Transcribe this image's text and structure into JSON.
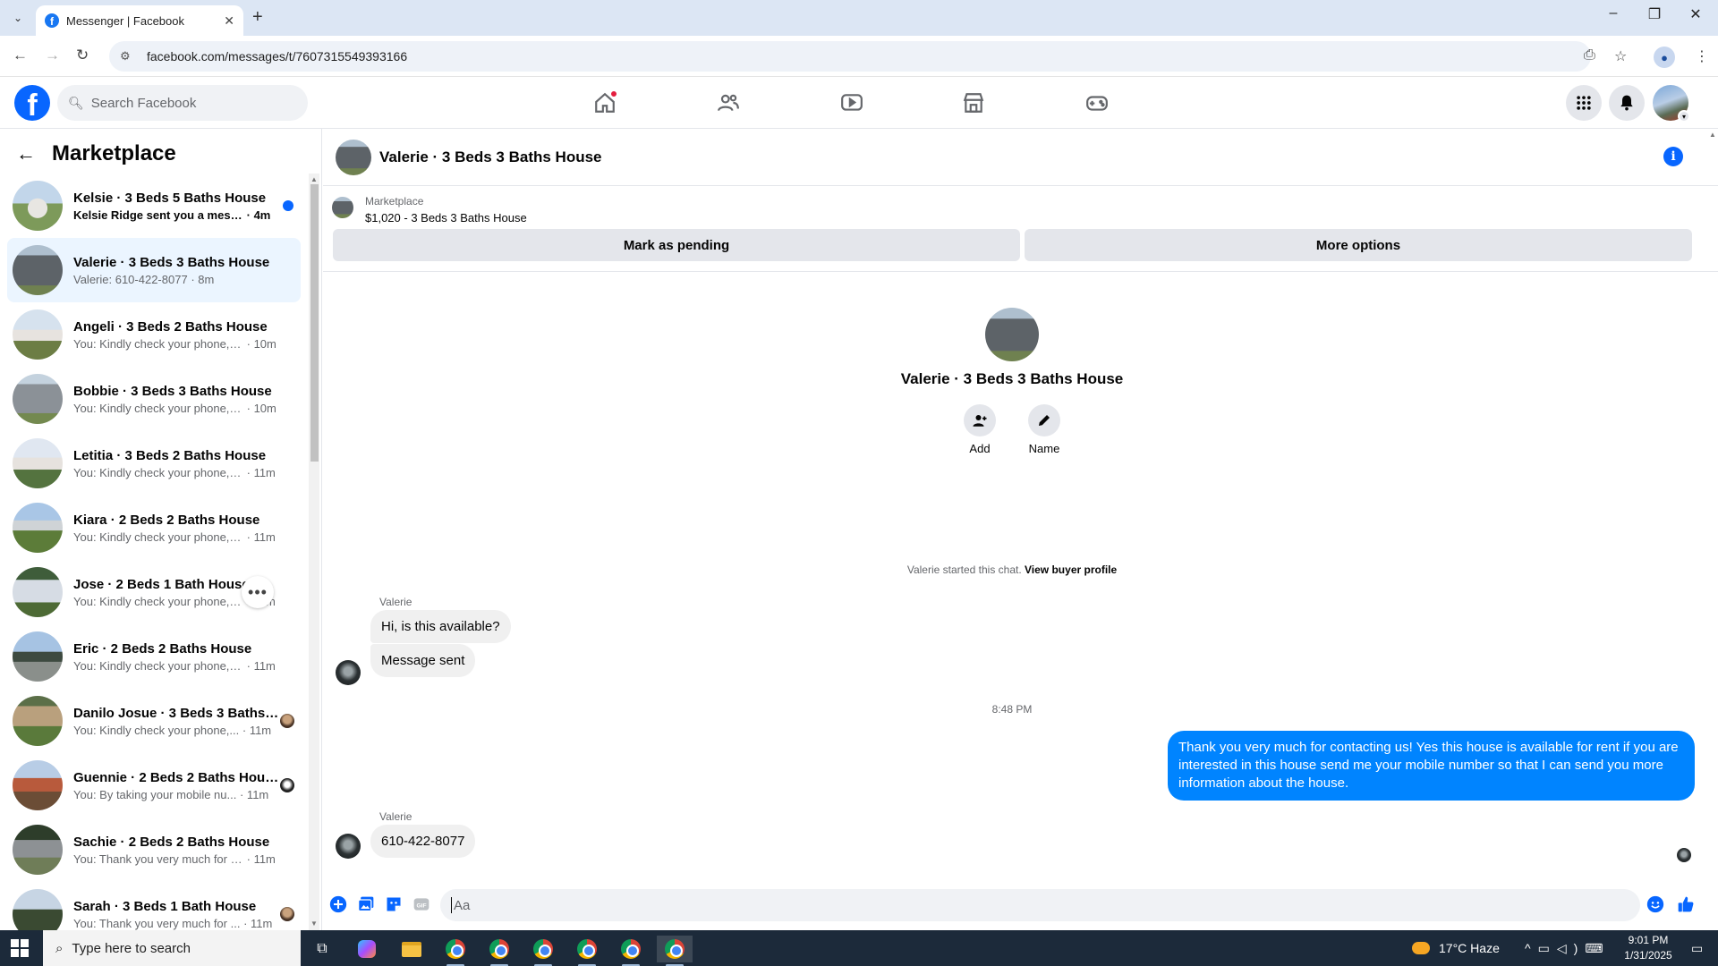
{
  "browser": {
    "tab_title": "Messenger | Facebook",
    "url": "facebook.com/messages/t/7607315549393166"
  },
  "fbnav": {
    "search_placeholder": "Search Facebook"
  },
  "sidebar": {
    "title": "Marketplace",
    "conversations": [
      {
        "name": "Kelsie · 3 Beds 5 Baths House",
        "preview": "Kelsie Ridge sent you a messag...",
        "time": "· 4m",
        "unread": true
      },
      {
        "name": "Valerie · 3 Beds 3 Baths House",
        "preview": "Valerie: 610-422-8077",
        "time": "· 8m",
        "active": true
      },
      {
        "name": "Angeli · 3 Beds 2 Baths House",
        "preview": "You: Kindly check your phone, I ...",
        "time": "· 10m"
      },
      {
        "name": "Bobbie · 3 Beds 3 Baths House",
        "preview": "You: Kindly check your phone, I ...",
        "time": "· 10m"
      },
      {
        "name": "Letitia · 3 Beds 2 Baths House",
        "preview": "You: Kindly check your phone, I ...",
        "time": "· 11m"
      },
      {
        "name": "Kiara · 2 Beds 2 Baths House",
        "preview": "You: Kindly check your phone, I ...",
        "time": "· 11m"
      },
      {
        "name": "Jose · 2 Beds 1 Bath House",
        "preview": "You: Kindly check your phone, I ...",
        "time": "· 11m"
      },
      {
        "name": "Eric · 2 Beds 2 Baths House",
        "preview": "You: Kindly check your phone, I ...",
        "time": "· 11m"
      },
      {
        "name": "Danilo Josue · 3 Beds 3 Baths ...",
        "preview": "You: Kindly check your phone,...",
        "time": "· 11m"
      },
      {
        "name": "Guennie · 2 Beds 2 Baths House",
        "preview": "You: By taking your mobile nu...",
        "time": "· 11m"
      },
      {
        "name": "Sachie · 2 Beds 2 Baths House",
        "preview": "You: Thank you very much for co...",
        "time": "· 11m"
      },
      {
        "name": "Sarah · 3 Beds 1 Bath House",
        "preview": "You: Thank you very much for ...",
        "time": "· 11m"
      }
    ]
  },
  "chat": {
    "header_title": "Valerie · 3 Beds 3 Baths House",
    "marketplace_label": "Marketplace",
    "listing": "$1,020 - 3 Beds 3 Baths House",
    "mark_pending": "Mark as pending",
    "more_options": "More options",
    "profile_name": "Valerie · 3 Beds 3 Baths House",
    "add_label": "Add",
    "name_label": "Name",
    "started_text": "Valerie started this chat.",
    "view_buyer": "View buyer profile",
    "sender": "Valerie",
    "msg1": "Hi, is this available?",
    "msg2": "Message sent",
    "timestamp": "8:48 PM",
    "outgoing": "Thank you very much for contacting us! Yes this house is available for rent if you are interested in this house send me your mobile number so that I can send you more information about the house.",
    "sender2": "Valerie",
    "msg3": "610-422-8077",
    "composer_placeholder": "Aa"
  },
  "taskbar": {
    "search_placeholder": "Type here to search",
    "weather": "17°C  Haze",
    "time": "9:01 PM",
    "date": "1/31/2025"
  },
  "colors": {
    "fb_blue": "#0866ff",
    "bubble_out": "#0084ff",
    "active_row": "#ebf5ff"
  }
}
